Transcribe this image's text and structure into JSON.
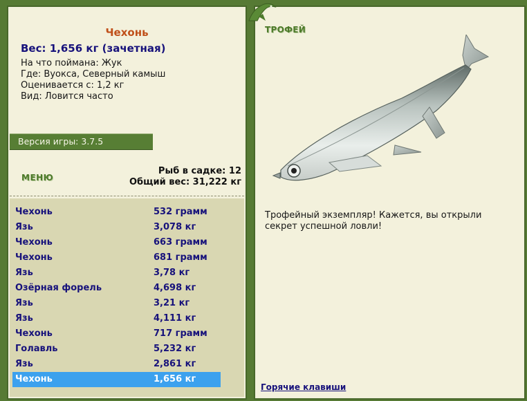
{
  "catch": {
    "title": "Чехонь",
    "weight_line": "Вес: 1,656 кг (зачетная)",
    "bait": "На что поймана: Жук",
    "place": "Где: Вуокса, Северный камыш",
    "value": "Оценивается с: 1,2 кг",
    "kind": "Вид: Ловится часто"
  },
  "version": "Версия игры: 3.7.5",
  "menu_label": "МЕНЮ",
  "keep": {
    "count_label": "Рыб в садке: 12",
    "total_label": "Общий вес: 31,222 кг",
    "rows": [
      {
        "name": "Чехонь",
        "weight": "532 грамм"
      },
      {
        "name": "Язь",
        "weight": "3,078 кг"
      },
      {
        "name": "Чехонь",
        "weight": "663 грамм"
      },
      {
        "name": "Чехонь",
        "weight": "681 грамм"
      },
      {
        "name": "Язь",
        "weight": "3,78 кг"
      },
      {
        "name": "Озёрная форель",
        "weight": "4,698 кг"
      },
      {
        "name": "Язь",
        "weight": "3,21 кг"
      },
      {
        "name": "Язь",
        "weight": "4,111 кг"
      },
      {
        "name": "Чехонь",
        "weight": "717 грамм"
      },
      {
        "name": "Голавль",
        "weight": "5,232 кг"
      },
      {
        "name": "Язь",
        "weight": "2,861 кг"
      },
      {
        "name": "Чехонь",
        "weight": "1,656 кг"
      }
    ],
    "selected_index": 11
  },
  "trophy": {
    "label": "ТРОФЕЙ",
    "text": "Трофейный экземпляр! Кажется, вы открыли секрет успешной ловли!"
  },
  "hotkeys_label": "Горячие клавиши",
  "colors": {
    "frame_green": "#567a34",
    "panel": "#f3f1dc",
    "list_bg": "#d9d7b2",
    "selection": "#3ca1ee",
    "title_orange": "#c0501a",
    "text_navy": "#17127b"
  }
}
